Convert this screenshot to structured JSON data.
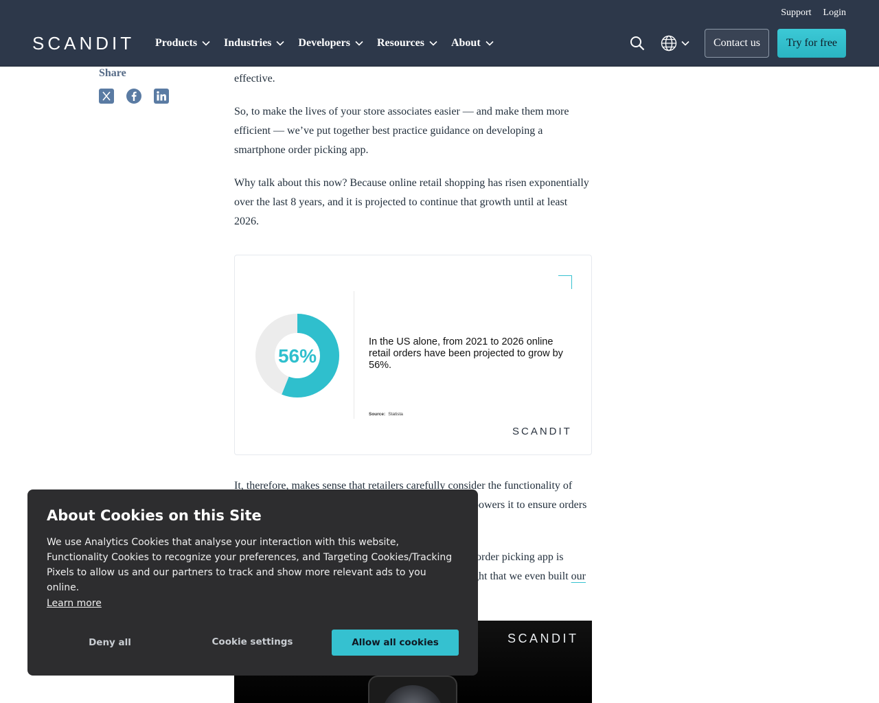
{
  "header": {
    "top_links": [
      "Support",
      "Login"
    ],
    "logo": "SCANDIT",
    "nav": [
      "Products",
      "Industries",
      "Developers",
      "Resources",
      "About"
    ],
    "contact_label": "Contact us",
    "try_label": "Try for free",
    "bg_color": "#263244",
    "accent_color": "#35c1d0"
  },
  "share": {
    "title": "Share",
    "icons": [
      "x-icon",
      "facebook-icon",
      "linkedin-icon"
    ]
  },
  "article": {
    "p1_tail": "effective.",
    "p2": "So, to make the lives of your store associates easier — and make them more efficient — we’ve put together best practice guidance on developing a smartphone order picking app.",
    "p3": "Why talk about this now? Because online retail shopping has risen exponentially over the last 8 years, and it is projected to continue that growth until at least 2026.",
    "p4_line1": "It, therefore, makes sense that retailers carefully consider the functionality of",
    "p4_line2_tail": "powers it to ensure orders",
    "p5_line1_tail": "order picking app is",
    "p5_line2_tail": "ght that we even built",
    "p5_link": "our"
  },
  "stat_card": {
    "percent_label": "56%",
    "percent_value": 56,
    "text": "In the US alone, from 2021 to 2026 online retail orders have been projected to grow by 56%.",
    "source_label": "Source:",
    "source_value": "Statista",
    "logo": "SCANDIT"
  },
  "promo": {
    "logo": "SCANDIT"
  },
  "cookie": {
    "title": "About Cookies on this Site",
    "body": "We use Analytics Cookies that analyse your interaction with this website, Functionality Cookies to recognize your preferences, and Targeting Cookies/Tracking Pixels to allow us and our partners to track and show more relevant ads to you online.",
    "learn_more": "Learn more",
    "deny": "Deny all",
    "settings": "Cookie settings",
    "allow": "Allow all cookies"
  }
}
